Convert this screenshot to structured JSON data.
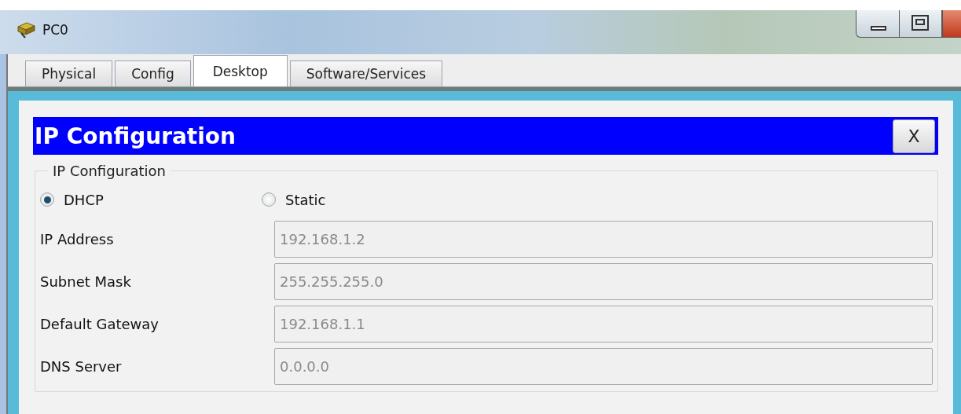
{
  "window": {
    "title": "PC0"
  },
  "tabs": [
    {
      "label": "Physical",
      "selected": false
    },
    {
      "label": "Config",
      "selected": false
    },
    {
      "label": "Desktop",
      "selected": true
    },
    {
      "label": "Software/Services",
      "selected": false
    }
  ],
  "dialog": {
    "title": "IP Configuration",
    "close_label": "X",
    "group_label": "IP Configuration",
    "modes": [
      {
        "label": "DHCP",
        "selected": true
      },
      {
        "label": "Static",
        "selected": false
      }
    ],
    "fields": [
      {
        "label": "IP Address",
        "value": "192.168.1.2",
        "disabled": true
      },
      {
        "label": "Subnet Mask",
        "value": "255.255.255.0",
        "disabled": true
      },
      {
        "label": "Default Gateway",
        "value": "192.168.1.1",
        "disabled": true
      },
      {
        "label": "DNS Server",
        "value": "0.0.0.0",
        "disabled": true
      }
    ]
  }
}
